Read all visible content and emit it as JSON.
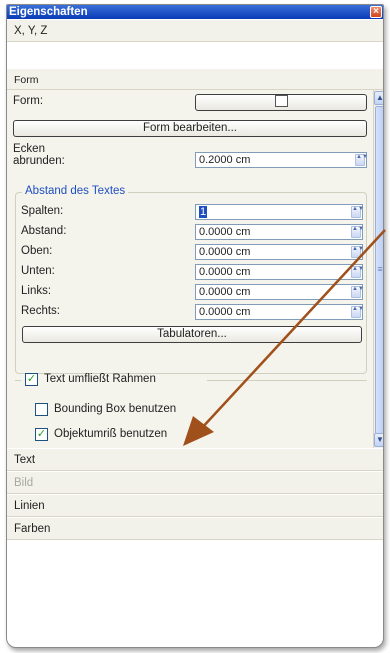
{
  "window": {
    "title": "Eigenschaften",
    "close_glyph": "×"
  },
  "sections": {
    "xyz": "X, Y, Z",
    "form": "Form",
    "text": "Text",
    "bild": "Bild",
    "linien": "Linien",
    "farben": "Farben"
  },
  "form_panel": {
    "form_label": "Form:",
    "form_edit_button": "Form bearbeiten...",
    "round_corners_label_line1": "Ecken",
    "round_corners_label_line2": "abrunden:",
    "round_corners_value": "0.2000 cm",
    "text_distance_group": {
      "title": "Abstand des Textes",
      "fields": [
        {
          "label": "Spalten:",
          "value": "1"
        },
        {
          "label": "Abstand:",
          "value": "0.0000 cm"
        },
        {
          "label": "Oben:",
          "value": "0.0000 cm"
        },
        {
          "label": "Unten:",
          "value": "0.0000 cm"
        },
        {
          "label": "Links:",
          "value": "0.0000 cm"
        },
        {
          "label": "Rechts:",
          "value": "0.0000 cm"
        }
      ],
      "tabs_button": "Tabulatoren..."
    },
    "checks": {
      "text_flow": {
        "label": "Text umfließt Rahmen",
        "checked": true,
        "glyph": "✓"
      },
      "bounding_box": {
        "label": "Bounding Box benutzen",
        "checked": false
      },
      "object_outline": {
        "label": "Objektumriß benutzen",
        "checked": true,
        "glyph": "✓"
      }
    }
  },
  "scrollbar": {
    "up_glyph": "▲",
    "down_glyph": "▼",
    "grip_glyph": "≡"
  },
  "spin_glyph": "▲▼",
  "colors": {
    "titlebar": "#0a3bb6",
    "group_title": "#1e4fc0",
    "check_mark": "#21a121",
    "annotation_arrow": "#a0501a"
  }
}
